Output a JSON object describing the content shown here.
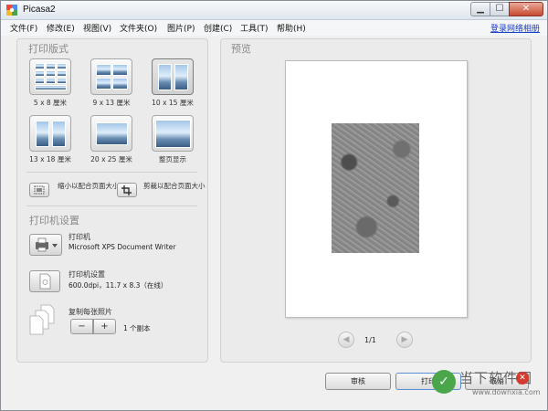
{
  "window": {
    "title": "Picasa2"
  },
  "menu": {
    "items": [
      "文件(F)",
      "修改(E)",
      "视图(V)",
      "文件夹(O)",
      "图片(P)",
      "创建(C)",
      "工具(T)",
      "帮助(H)"
    ],
    "login": "登录网络相册"
  },
  "layout_section": {
    "title": "打印版式",
    "options": [
      {
        "label": "5 x 8 厘米",
        "icon": "grid-8-photos-icon"
      },
      {
        "label": "9 x 13 厘米",
        "icon": "grid-4-photos-icon"
      },
      {
        "label": "10 x 15 厘米",
        "icon": "two-photos-icon",
        "selected": true
      },
      {
        "label": "13 x 18 厘米",
        "icon": "two-photos-portrait-icon"
      },
      {
        "label": "20 x 25 厘米",
        "icon": "single-photo-icon"
      },
      {
        "label": "整页显示",
        "icon": "full-page-icon"
      }
    ],
    "fit_shrink": "缩小以配合页面大小",
    "fit_crop": "剪裁以配合页面大小"
  },
  "printer_section": {
    "title": "打印机设置",
    "printer_label": "打印机",
    "printer_name": "Microsoft XPS Document Writer",
    "settings_label": "打印机设置",
    "settings_value": "600.0dpi，11.7 x 8.3（在线）",
    "copies_label": "复制每张照片",
    "minus": "−",
    "plus": "+",
    "copies_value": "1 个副本"
  },
  "preview": {
    "title": "预览",
    "page_indicator": "1/1",
    "prev": "◀",
    "next": "▶"
  },
  "actions": {
    "review": "审核",
    "print": "打印",
    "cancel": "取消"
  },
  "watermark": {
    "main": "当下软件园",
    "sub": "www.downxia.com"
  }
}
